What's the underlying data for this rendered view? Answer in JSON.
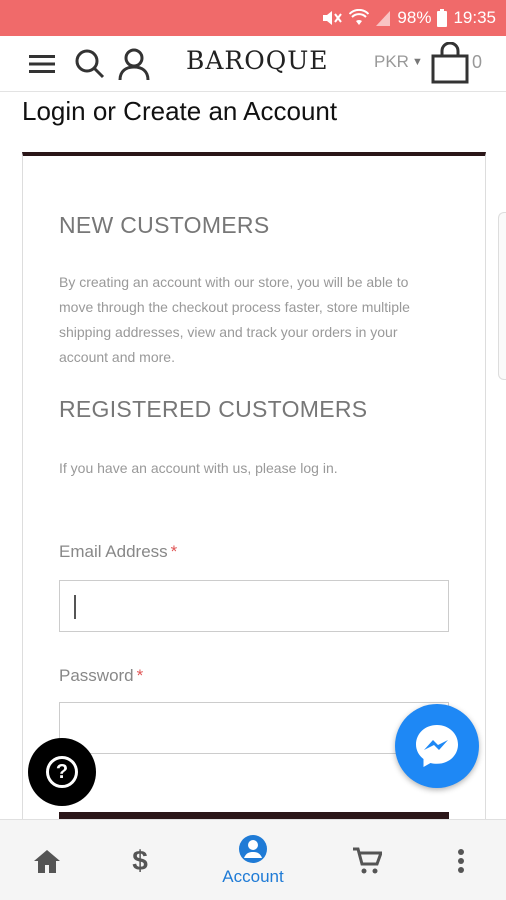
{
  "status_bar": {
    "battery": "98%",
    "time": "19:35",
    "icons": [
      "mute-icon",
      "wifi-icon",
      "signal-icon",
      "battery-icon"
    ]
  },
  "header": {
    "logo": "BAROQUE",
    "currency": "PKR",
    "cart_count": "0",
    "icons": [
      "menu-icon",
      "search-icon",
      "user-icon",
      "cart-icon"
    ]
  },
  "page": {
    "title": "Login or Create an Account"
  },
  "new_customers": {
    "heading": "NEW CUSTOMERS",
    "lines": [
      "By creating an account with our store, you will be able to",
      "move through the checkout process faster, store multiple",
      "shipping addresses, view and track your orders in your",
      "account and more."
    ]
  },
  "registered_customers": {
    "heading": "REGISTERED CUSTOMERS",
    "text": "If you have an account with us, please log in."
  },
  "form": {
    "email_label": "Email Address",
    "password_label": "Password",
    "required_mark": "*",
    "email_value": "",
    "password_value": ""
  },
  "bottom_nav": {
    "items": [
      {
        "icon": "home-icon",
        "label": ""
      },
      {
        "icon": "dollar-icon",
        "label": ""
      },
      {
        "icon": "account-icon",
        "label": "Account"
      },
      {
        "icon": "cart-icon",
        "label": ""
      },
      {
        "icon": "more-icon",
        "label": ""
      }
    ]
  },
  "colors": {
    "status_bar": "#f06a6a",
    "accent_dark": "#2a1618",
    "nav_active": "#1f7bd6",
    "messenger": "#1e88f5"
  }
}
